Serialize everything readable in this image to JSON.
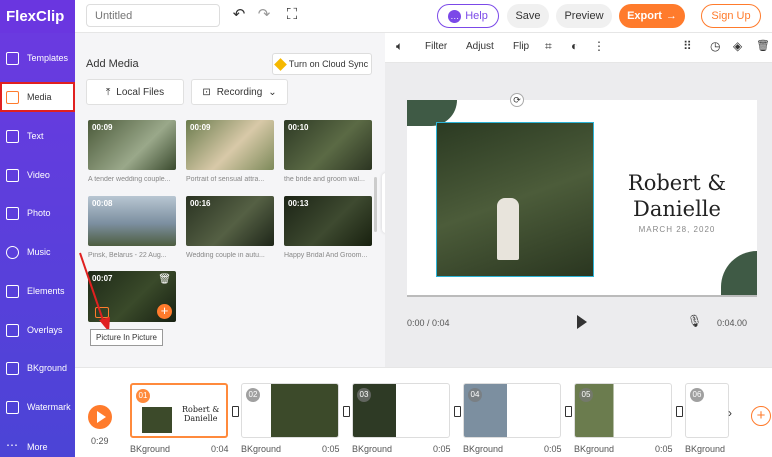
{
  "app": {
    "logo_text": "FlexClip"
  },
  "topbar": {
    "title_placeholder": "Untitled",
    "help_label": "Help",
    "save_label": "Save",
    "preview_label": "Preview",
    "export_label": "Export",
    "signup_label": "Sign Up"
  },
  "sidebar": {
    "items": [
      {
        "label": "Templates"
      },
      {
        "label": "Media"
      },
      {
        "label": "Text"
      },
      {
        "label": "Video"
      },
      {
        "label": "Photo"
      },
      {
        "label": "Music"
      },
      {
        "label": "Elements"
      },
      {
        "label": "Overlays"
      },
      {
        "label": "BKground"
      },
      {
        "label": "Watermark"
      },
      {
        "label": "More"
      }
    ]
  },
  "media": {
    "heading": "Add Media",
    "cloud_sync_label": "Turn on Cloud Sync",
    "local_files_label": "Local Files",
    "recording_label": "Recording",
    "items": [
      {
        "duration": "00:09",
        "caption": "A tender wedding couple..."
      },
      {
        "duration": "00:09",
        "caption": "Portrait of sensual attra..."
      },
      {
        "duration": "00:10",
        "caption": "the bride and groom wal..."
      },
      {
        "duration": "00:08",
        "caption": "Pinsk, Belarus - 22 Aug..."
      },
      {
        "duration": "00:16",
        "caption": "Wedding couple in autu..."
      },
      {
        "duration": "00:13",
        "caption": "Happy Bridal And Groom..."
      },
      {
        "duration": "00:07",
        "caption": ""
      }
    ],
    "tooltip": "Picture In Picture"
  },
  "edit_toolbar": {
    "filter_label": "Filter",
    "adjust_label": "Adjust",
    "flip_label": "Flip"
  },
  "slide": {
    "name_line1": "Robert &",
    "name_line2": "Danielle",
    "date": "MARCH 28, 2020"
  },
  "player": {
    "current_time": "0:00 / 0:04",
    "end_time": "0:04.00"
  },
  "timeline": {
    "total": "0:29",
    "clips": [
      {
        "num": "01",
        "label": "BKground",
        "dur": "0:04"
      },
      {
        "num": "02",
        "label": "BKground",
        "dur": "0:05"
      },
      {
        "num": "03",
        "label": "BKground",
        "dur": "0:05"
      },
      {
        "num": "04",
        "label": "BKground",
        "dur": "0:05"
      },
      {
        "num": "05",
        "label": "BKground",
        "dur": "0:05"
      },
      {
        "num": "06",
        "label": "BKground",
        "dur": ""
      }
    ]
  },
  "colors": {
    "brand_purple": "#6a36e0",
    "accent_orange": "#ff7b2c",
    "highlight_red": "#e02020",
    "selection_cyan": "#2bb3d6"
  }
}
